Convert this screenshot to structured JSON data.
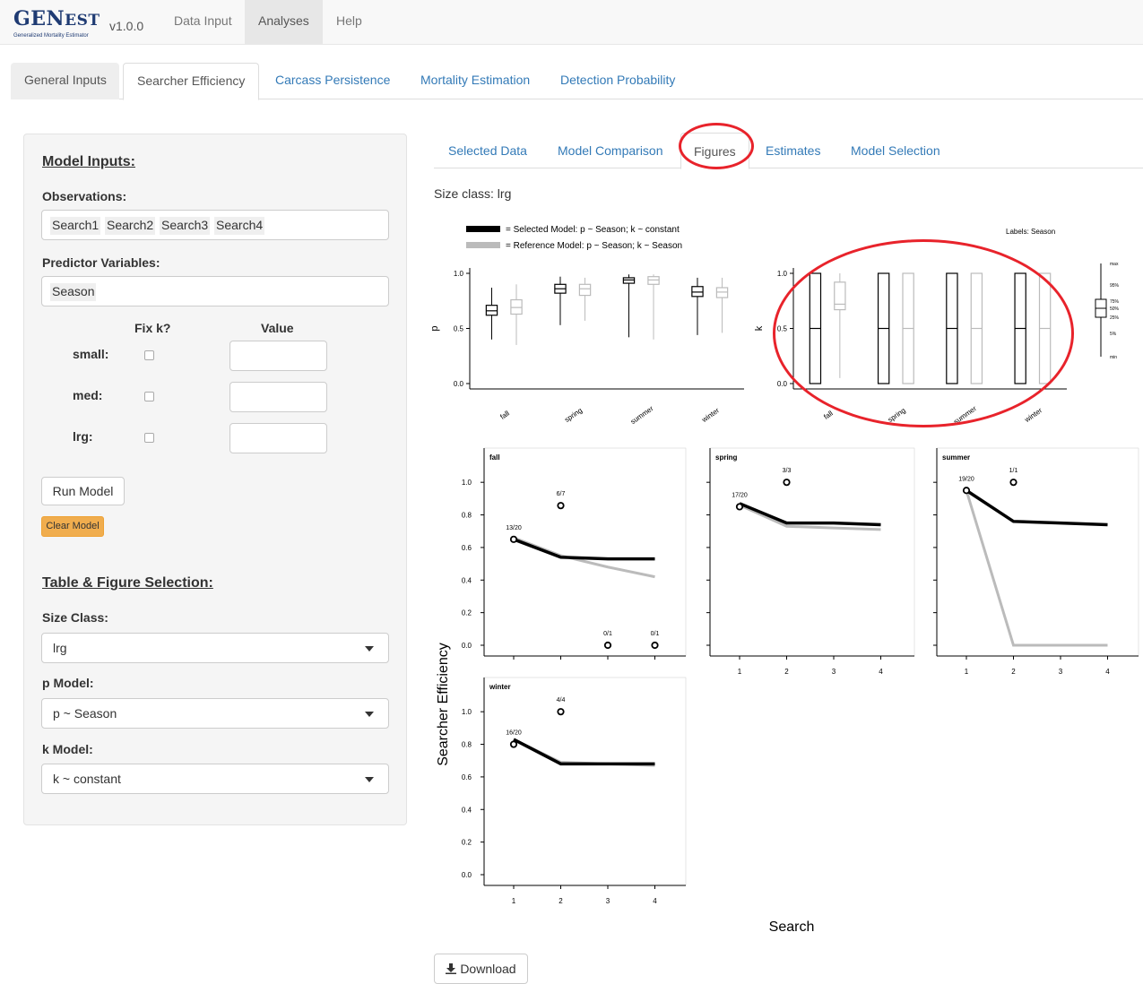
{
  "app": {
    "name": "GenEst",
    "name_big": "GEN",
    "name_small": "EST",
    "name_big2": "E",
    "name_rest1": "N",
    "name_rest2": "ST",
    "version": "v1.0.0",
    "subtitle": "Generalized Mortality Estimator"
  },
  "nav": {
    "items": [
      {
        "label": "Data Input"
      },
      {
        "label": "Analyses"
      },
      {
        "label": "Help"
      }
    ],
    "active": "Analyses"
  },
  "tabs": {
    "items": [
      {
        "label": "General Inputs"
      },
      {
        "label": "Searcher Efficiency"
      },
      {
        "label": "Carcass Persistence"
      },
      {
        "label": "Mortality Estimation"
      },
      {
        "label": "Detection Probability"
      }
    ],
    "active": "Searcher Efficiency"
  },
  "sidebar": {
    "model_inputs_title": "Model Inputs:",
    "observations_label": "Observations:",
    "observations": [
      "Search1",
      "Search2",
      "Search3",
      "Search4"
    ],
    "predictor_label": "Predictor Variables:",
    "predictors": [
      "Season"
    ],
    "fixk_header": "Fix k?",
    "value_header": "Value",
    "size_rows": [
      {
        "label": "small:"
      },
      {
        "label": "med:"
      },
      {
        "label": "lrg:"
      }
    ],
    "run_button": "Run Model",
    "clear_button": "Clear Model",
    "selection_title": "Table & Figure Selection:",
    "size_class_label": "Size Class:",
    "size_class_value": "lrg",
    "p_model_label": "p Model:",
    "p_model_value": "p ~ Season",
    "k_model_label": "k Model:",
    "k_model_value": "k ~ constant"
  },
  "subtabs": {
    "items": [
      {
        "label": "Selected Data"
      },
      {
        "label": "Model Comparison"
      },
      {
        "label": "Figures"
      },
      {
        "label": "Estimates"
      },
      {
        "label": "Model Selection"
      }
    ],
    "active": "Figures"
  },
  "size_class_text": "Size class: lrg",
  "download_label": "Download",
  "colors": {
    "accent": "#337ab7",
    "highlight": "#e8232b",
    "selected": "#000000",
    "reference": "#bbbbbb",
    "warn": "#f0ad4e"
  },
  "chart_data": [
    {
      "type": "box",
      "legend": [
        "= Selected Model: p ~ Season; k ~ constant",
        "= Reference Model: p ~ Season; k ~ Season"
      ],
      "ylabel": "p",
      "yticks": [
        "0.0",
        "0.5",
        "1.0"
      ],
      "ylim": [
        0,
        1
      ],
      "categories": [
        "fall",
        "spring",
        "summer",
        "winter"
      ],
      "series": [
        {
          "name": "Selected Model",
          "boxes": [
            {
              "min": 0.4,
              "q1": 0.62,
              "median": 0.66,
              "q3": 0.71,
              "max": 0.87
            },
            {
              "min": 0.53,
              "q1": 0.82,
              "median": 0.86,
              "q3": 0.9,
              "max": 0.97
            },
            {
              "min": 0.42,
              "q1": 0.91,
              "median": 0.94,
              "q3": 0.96,
              "max": 0.99
            },
            {
              "min": 0.44,
              "q1": 0.79,
              "median": 0.83,
              "q3": 0.88,
              "max": 0.96
            }
          ]
        },
        {
          "name": "Reference Model",
          "boxes": [
            {
              "min": 0.35,
              "q1": 0.63,
              "median": 0.69,
              "q3": 0.76,
              "max": 0.9
            },
            {
              "min": 0.57,
              "q1": 0.8,
              "median": 0.86,
              "q3": 0.9,
              "max": 0.96
            },
            {
              "min": 0.4,
              "q1": 0.9,
              "median": 0.94,
              "q3": 0.97,
              "max": 0.99
            },
            {
              "min": 0.46,
              "q1": 0.78,
              "median": 0.83,
              "q3": 0.87,
              "max": 0.96
            }
          ]
        }
      ]
    },
    {
      "type": "box",
      "note": "Labels: Season",
      "ylabel": "k",
      "yticks": [
        "0.0",
        "0.5",
        "1.0"
      ],
      "ylim": [
        0,
        1
      ],
      "categories": [
        "fall",
        "spring",
        "summer",
        "winter"
      ],
      "series": [
        {
          "name": "Selected Model",
          "boxes": [
            {
              "min": 0,
              "q1": 0,
              "median": 0.5,
              "q3": 1,
              "max": 1
            },
            {
              "min": 0,
              "q1": 0,
              "median": 0.5,
              "q3": 1,
              "max": 1
            },
            {
              "min": 0,
              "q1": 0,
              "median": 0.5,
              "q3": 1,
              "max": 1
            },
            {
              "min": 0,
              "q1": 0,
              "median": 0.5,
              "q3": 1,
              "max": 1
            }
          ]
        },
        {
          "name": "Reference Model",
          "boxes": [
            {
              "min": 0.05,
              "q1": 0.67,
              "median": 0.72,
              "q3": 0.92,
              "max": 1
            },
            {
              "min": 0,
              "q1": 0,
              "median": 0.5,
              "q3": 1,
              "max": 1
            },
            {
              "min": 0,
              "q1": 0,
              "median": 0.5,
              "q3": 1,
              "max": 1
            },
            {
              "min": 0,
              "q1": 0,
              "median": 0.5,
              "q3": 1,
              "max": 1
            }
          ]
        }
      ],
      "key_labels": [
        "max",
        "95%",
        "75%",
        "50%",
        "25%",
        "5%",
        "min"
      ]
    },
    {
      "type": "line",
      "ylabel": "Searcher Efficiency",
      "xlabel": "Search",
      "yticks": [
        "0.0",
        "0.2",
        "0.4",
        "0.6",
        "0.8",
        "1.0"
      ],
      "xticks": [
        "1",
        "2",
        "3",
        "4"
      ],
      "ylim": [
        0,
        1.1
      ],
      "panels": [
        {
          "title": "fall",
          "selected": [
            0.65,
            0.54,
            0.53,
            0.53
          ],
          "reference": [
            0.66,
            0.55,
            0.48,
            0.42
          ],
          "observed": [
            {
              "x": 1,
              "y": 0.65,
              "label": "13/20"
            },
            {
              "x": 2,
              "y": 0.857,
              "label": "6/7"
            },
            {
              "x": 3,
              "y": 0,
              "label": "0/1"
            },
            {
              "x": 4,
              "y": 0,
              "label": "0/1"
            }
          ]
        },
        {
          "title": "spring",
          "selected": [
            0.87,
            0.75,
            0.75,
            0.74
          ],
          "reference": [
            0.86,
            0.73,
            0.72,
            0.71
          ],
          "observed": [
            {
              "x": 1,
              "y": 0.85,
              "label": "17/20"
            },
            {
              "x": 2,
              "y": 1,
              "label": "3/3"
            }
          ]
        },
        {
          "title": "summer",
          "selected": [
            0.95,
            0.76,
            0.75,
            0.74
          ],
          "reference": [
            0.95,
            0,
            0,
            0
          ],
          "observed": [
            {
              "x": 1,
              "y": 0.95,
              "label": "19/20"
            },
            {
              "x": 2,
              "y": 1,
              "label": "1/1"
            }
          ]
        },
        {
          "title": "winter",
          "selected": [
            0.83,
            0.68,
            0.68,
            0.68
          ],
          "reference": [
            0.83,
            0.69,
            0.68,
            0.67
          ],
          "observed": [
            {
              "x": 1,
              "y": 0.8,
              "label": "16/20"
            },
            {
              "x": 2,
              "y": 1,
              "label": "4/4"
            }
          ]
        }
      ]
    }
  ]
}
